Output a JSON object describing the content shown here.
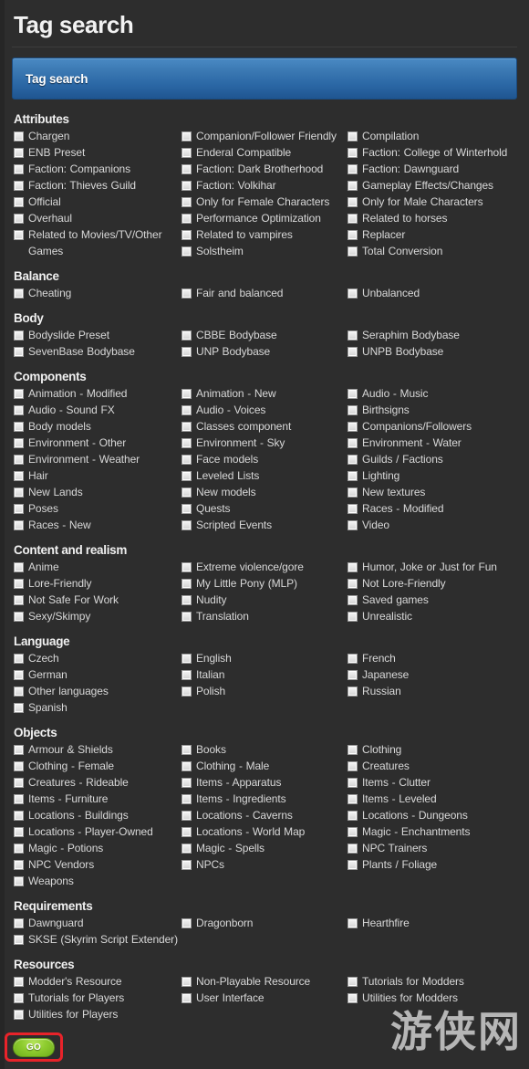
{
  "header": {
    "title": "Tag search"
  },
  "searchbar": {
    "label": "Tag search"
  },
  "watermark": {
    "text": "游侠网"
  },
  "go": {
    "label": "GO"
  },
  "colors": {
    "page_background": "#2d2d2d",
    "searchbar_blue": "#3c7ab4",
    "go_green": "#8dcb2e",
    "highlight_red": "#e8232a",
    "text": "#d8d8d8"
  },
  "sections": [
    {
      "title": "Attributes",
      "columns": [
        [
          "Chargen",
          "ENB Preset",
          "Faction: Companions",
          "Faction: Thieves Guild",
          "Official",
          "Overhaul",
          "Related to Movies/TV/Other Games"
        ],
        [
          "Companion/Follower Friendly",
          "Enderal Compatible",
          "Faction: Dark Brotherhood",
          "Faction: Volkihar",
          "Only for Female Characters",
          "Performance Optimization",
          "Related to vampires",
          "Solstheim"
        ],
        [
          "Compilation",
          "Faction: College of Winterhold",
          "Faction: Dawnguard",
          "Gameplay Effects/Changes",
          "Only for Male Characters",
          "Related to horses",
          "Replacer",
          "Total Conversion"
        ]
      ]
    },
    {
      "title": "Balance",
      "columns": [
        [
          "Cheating"
        ],
        [
          "Fair and balanced"
        ],
        [
          "Unbalanced"
        ]
      ]
    },
    {
      "title": "Body",
      "columns": [
        [
          "Bodyslide Preset",
          "SevenBase Bodybase"
        ],
        [
          "CBBE Bodybase",
          "UNP Bodybase"
        ],
        [
          "Seraphim Bodybase",
          "UNPB Bodybase"
        ]
      ]
    },
    {
      "title": "Components",
      "columns": [
        [
          "Animation - Modified",
          "Audio - Sound FX",
          "Body models",
          "Environment - Other",
          "Environment - Weather",
          "Hair",
          "New Lands",
          "Poses",
          "Races - New"
        ],
        [
          "Animation - New",
          "Audio - Voices",
          "Classes component",
          "Environment - Sky",
          "Face models",
          "Leveled Lists",
          "New models",
          "Quests",
          "Scripted Events"
        ],
        [
          "Audio - Music",
          "Birthsigns",
          "Companions/Followers",
          "Environment - Water",
          "Guilds / Factions",
          "Lighting",
          "New textures",
          "Races - Modified",
          "Video"
        ]
      ]
    },
    {
      "title": "Content and realism",
      "columns": [
        [
          "Anime",
          "Lore-Friendly",
          "Not Safe For Work",
          "Sexy/Skimpy"
        ],
        [
          "Extreme violence/gore",
          "My Little Pony (MLP)",
          "Nudity",
          "Translation"
        ],
        [
          "Humor, Joke or Just for Fun",
          "Not Lore-Friendly",
          "Saved games",
          "Unrealistic"
        ]
      ]
    },
    {
      "title": "Language",
      "columns": [
        [
          "Czech",
          "German",
          "Other languages",
          "Spanish"
        ],
        [
          "English",
          "Italian",
          "Polish"
        ],
        [
          "French",
          "Japanese",
          "Russian"
        ]
      ]
    },
    {
      "title": "Objects",
      "columns": [
        [
          "Armour & Shields",
          "Clothing - Female",
          "Creatures - Rideable",
          "Items - Furniture",
          "Locations - Buildings",
          "Locations - Player-Owned",
          "Magic - Potions",
          "NPC Vendors",
          "Weapons"
        ],
        [
          "Books",
          "Clothing - Male",
          "Items - Apparatus",
          "Items - Ingredients",
          "Locations - Caverns",
          "Locations - World Map",
          "Magic - Spells",
          "NPCs"
        ],
        [
          "Clothing",
          "Creatures",
          "Items - Clutter",
          "Items - Leveled",
          "Locations - Dungeons",
          "Magic - Enchantments",
          "NPC Trainers",
          "Plants / Foliage"
        ]
      ]
    },
    {
      "title": "Requirements",
      "columns": [
        [
          "Dawnguard",
          "SKSE (Skyrim Script Extender)"
        ],
        [
          "Dragonborn"
        ],
        [
          "Hearthfire"
        ]
      ]
    },
    {
      "title": "Resources",
      "columns": [
        [
          "Modder's Resource",
          "Tutorials for Players",
          "Utilities for Players"
        ],
        [
          "Non-Playable Resource",
          "User Interface"
        ],
        [
          "Tutorials for Modders",
          "Utilities for Modders"
        ]
      ]
    }
  ]
}
